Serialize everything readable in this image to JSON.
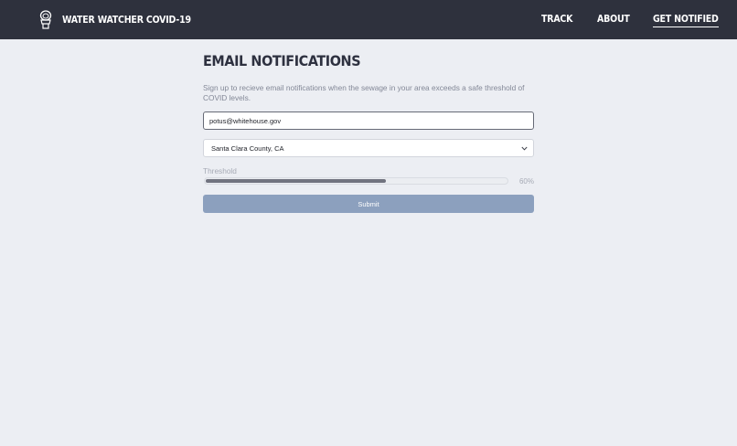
{
  "nav": {
    "brand_icon": "toilet-icon",
    "brand_title": "Water Watcher COVID-19",
    "links": [
      {
        "label": "Track",
        "active": false
      },
      {
        "label": "About",
        "active": false
      },
      {
        "label": "Get Notified",
        "active": true
      }
    ]
  },
  "form": {
    "title": "Email Notifications",
    "description": "Sign up to recieve email notifications when the sewage in your area exceeds a safe threshold of COVID levels.",
    "email_value": "potus@whitehouse.gov",
    "county_selected": "Santa Clara County, CA",
    "threshold_label": "Threshold",
    "threshold_value": 60,
    "threshold_display": "60%",
    "submit_label": "Submit"
  },
  "colors": {
    "navbar": "#2e313d",
    "background": "#eceef3",
    "submit": "#8ca0be",
    "slider_fill": "#71737f"
  }
}
